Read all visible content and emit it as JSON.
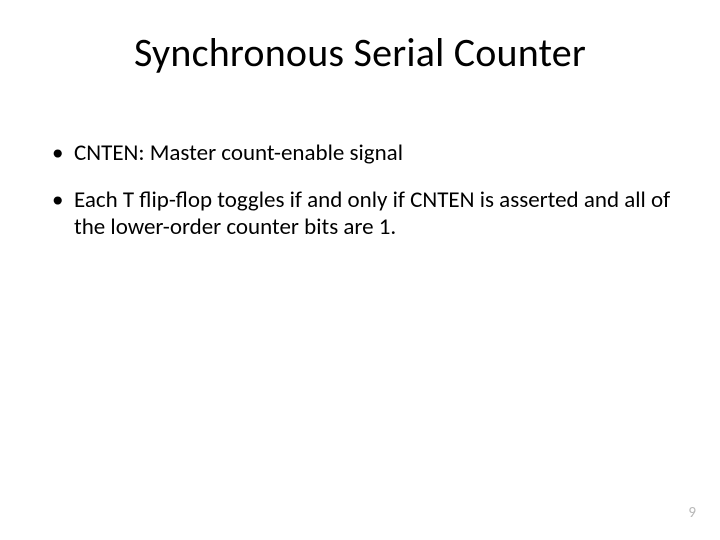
{
  "title": "Synchronous Serial Counter",
  "bullets": [
    "CNTEN:  Master count-enable signal",
    "Each T flip-flop toggles if and only if CNTEN is asserted and all of the lower-order counter bits are 1."
  ],
  "page_number": "9"
}
